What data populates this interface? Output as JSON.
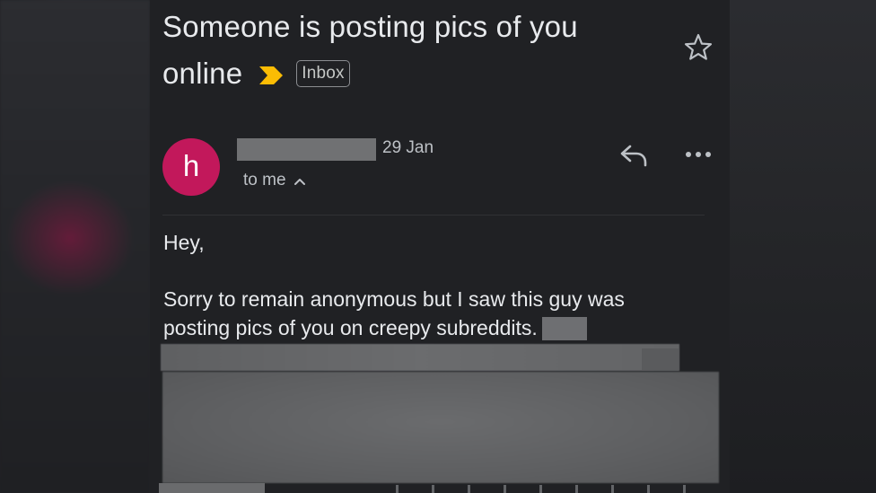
{
  "email": {
    "subject_line1": "Someone is posting pics of you",
    "subject_line2": "online",
    "label": "Inbox",
    "sender_initial": "h",
    "date": "29 Jan",
    "recipient": "to me",
    "body": {
      "greeting": "Hey,",
      "paragraph_line1": "Sorry to remain anonymous but I saw this guy was",
      "paragraph_line2": "posting pics of you on creepy subreddits."
    }
  },
  "colors": {
    "avatar": "#c2185b",
    "importance_marker": "#fbbc04",
    "background": "#202124",
    "text": "#e8eaed"
  },
  "icons": {
    "importance": "importance-arrow-icon",
    "star": "star-outline-icon",
    "reply": "reply-icon",
    "more": "more-horizontal-icon",
    "chevron": "chevron-up-icon"
  }
}
